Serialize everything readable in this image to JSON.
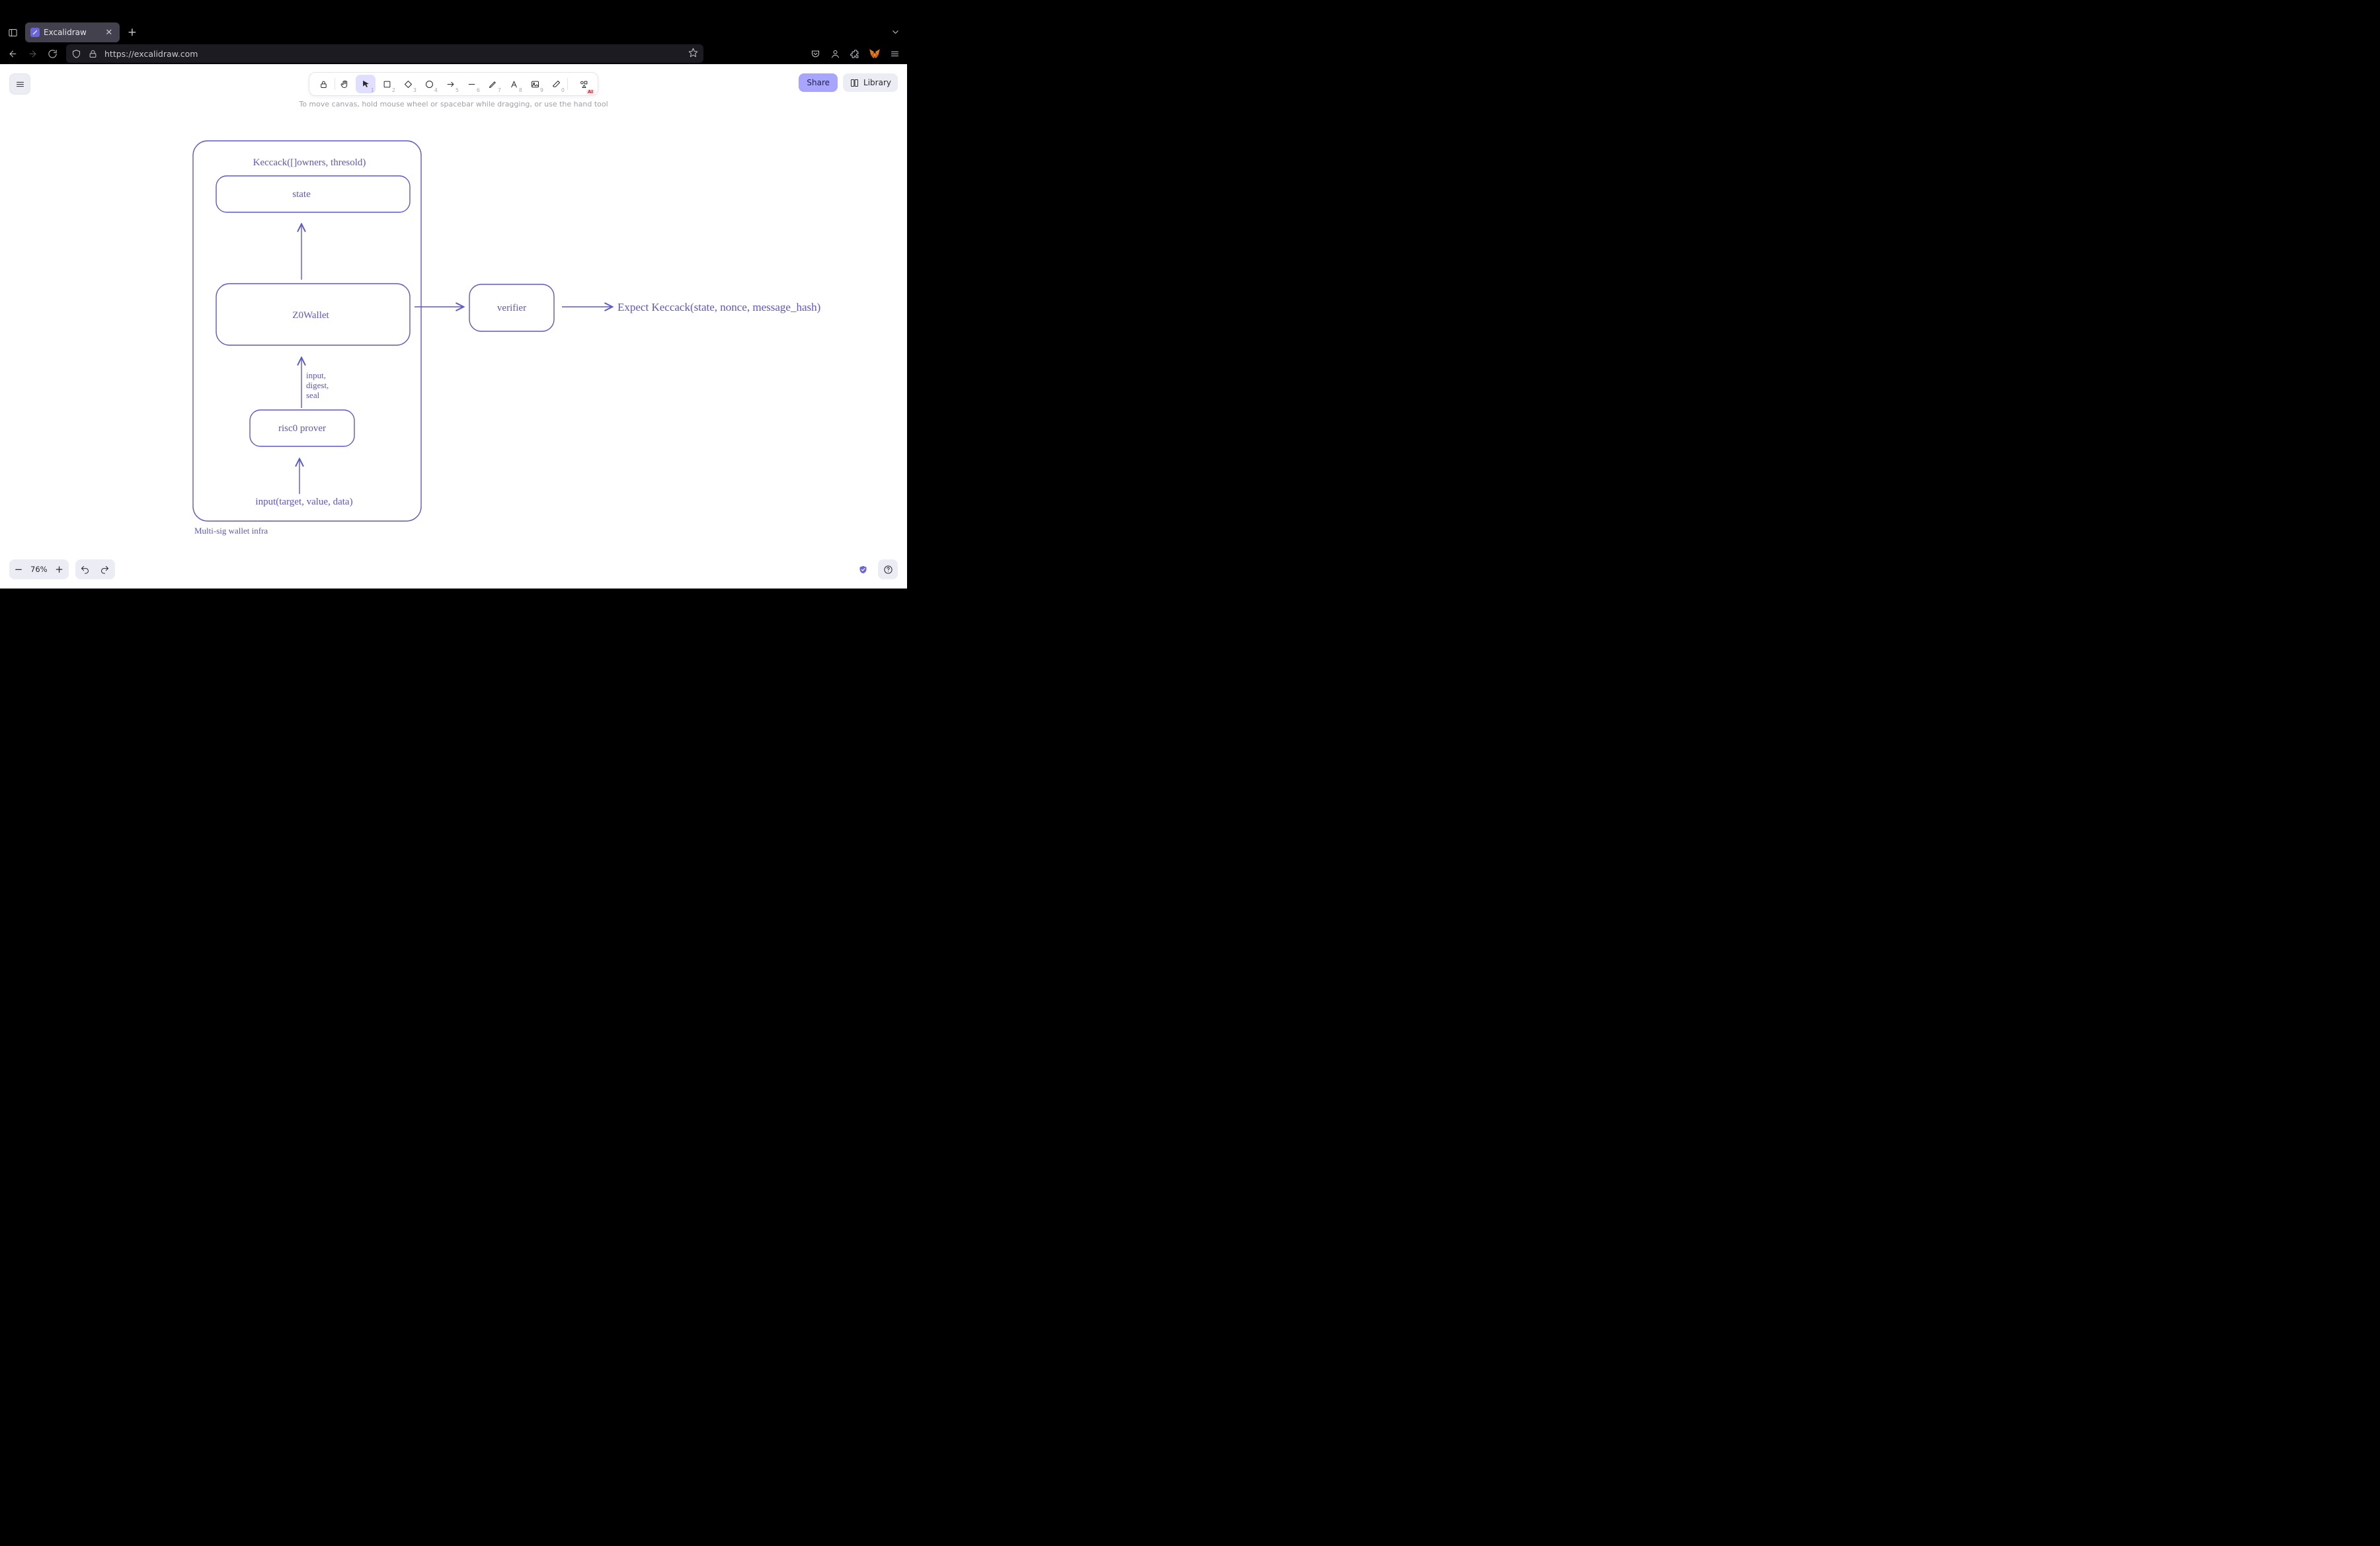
{
  "browser": {
    "tab_title": "Excalidraw",
    "url": "https://excalidraw.com",
    "new_tab_label": "+"
  },
  "app": {
    "share_label": "Share",
    "library_label": "Library",
    "hint": "To move canvas, hold mouse wheel or spacebar while dragging, or use the hand tool",
    "zoom_value": "76%",
    "ai_badge": "AI",
    "tools": [
      {
        "name": "lock",
        "num": "",
        "active": false
      },
      {
        "name": "hand",
        "num": "",
        "active": false
      },
      {
        "name": "select",
        "num": "1",
        "active": true
      },
      {
        "name": "rect",
        "num": "2",
        "active": false
      },
      {
        "name": "diamond",
        "num": "3",
        "active": false
      },
      {
        "name": "ellipse",
        "num": "4",
        "active": false
      },
      {
        "name": "arrow",
        "num": "5",
        "active": false
      },
      {
        "name": "line",
        "num": "6",
        "active": false
      },
      {
        "name": "draw",
        "num": "7",
        "active": false
      },
      {
        "name": "text",
        "num": "8",
        "active": false
      },
      {
        "name": "image",
        "num": "9",
        "active": false
      },
      {
        "name": "eraser",
        "num": "0",
        "active": false
      },
      {
        "name": "ai",
        "num": "",
        "active": false
      }
    ]
  },
  "diagram": {
    "container_label": "Multi-sig wallet infra",
    "header_text": "Keccack([]owners, thresold)",
    "state_label": "state",
    "wallet_label": "Z0Wallet",
    "prover_label": "risc0 prover",
    "verifier_label": "verifier",
    "expect_label": "Expect Keccack(state, nonce, message_hash)",
    "input_label": "input(target, value, data)",
    "side_label_1": "input,",
    "side_label_2": "digest,",
    "side_label_3": "seal"
  }
}
